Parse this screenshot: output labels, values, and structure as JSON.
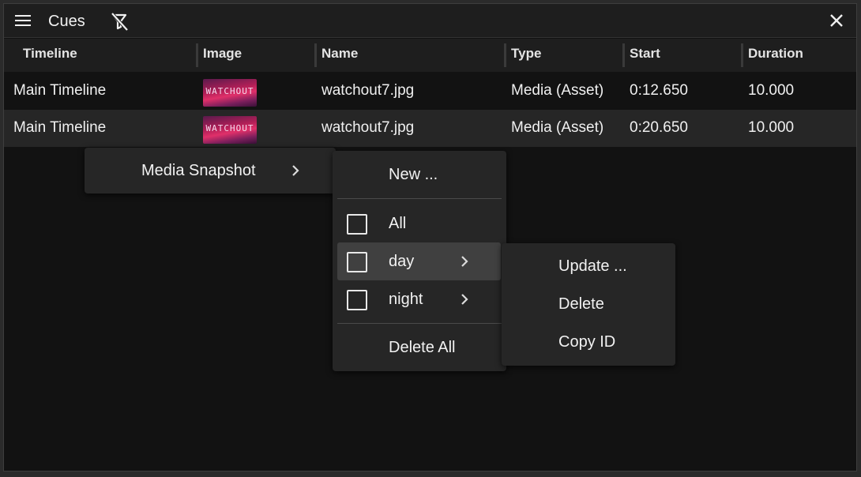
{
  "panel": {
    "title": "Cues",
    "icons": {
      "menu": "hamburger-icon",
      "filter": "filter-off-icon",
      "close": "close-icon"
    }
  },
  "table": {
    "columns": [
      "Timeline",
      "Image",
      "Name",
      "Type",
      "Start",
      "Duration"
    ],
    "rows": [
      {
        "timeline": "Main Timeline",
        "image_text": "WATCHOUT",
        "name": "watchout7.jpg",
        "type": "Media (Asset)",
        "start": "0:12.650",
        "duration": "10.000"
      },
      {
        "timeline": "Main Timeline",
        "image_text": "WATCHOUT",
        "name": "watchout7.jpg",
        "type": "Media (Asset)",
        "start": "0:20.650",
        "duration": "10.000"
      }
    ]
  },
  "context_menu": {
    "item": "Media Snapshot"
  },
  "snapshot_menu": {
    "new_label": "New ...",
    "items": [
      {
        "label": "All",
        "checked": false,
        "submenu": false
      },
      {
        "label": "day",
        "checked": false,
        "submenu": true
      },
      {
        "label": "night",
        "checked": false,
        "submenu": true
      }
    ],
    "delete_all_label": "Delete All"
  },
  "snapshot_submenu": {
    "items": [
      "Update ...",
      "Delete",
      "Copy ID"
    ]
  },
  "colors": {
    "background": "#121212",
    "header": "#1e1e1e",
    "menu": "#262626",
    "hover": "#404040"
  }
}
